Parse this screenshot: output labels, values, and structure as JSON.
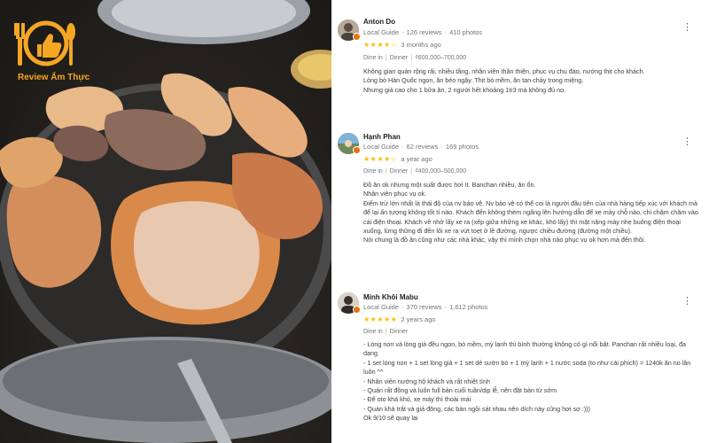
{
  "logo": {
    "text": "Review Ẩm Thực",
    "accent": "#f5a623"
  },
  "colors": {
    "star": "#fbbc04",
    "badge": "#e8710a",
    "meta": "#70757a"
  },
  "reviews": [
    {
      "name": "Anton Do",
      "guide": "Local Guide",
      "reviews_count": "126 reviews",
      "photos_count": "410 photos",
      "stars": "★★★★☆",
      "rating": 4,
      "time": "3 months ago",
      "meal": "Dine in",
      "meal_type": "Dinner",
      "price": "₫600,000–700,000",
      "text": "Không gian quán rộng rãi, nhiều tầng, nhân viên thân thiện, phục vụ chu đáo, nướng thịt cho khách.\nLòng bò Hàn Quốc ngon, ăn béo ngậy. Thịt bò mềm, ăn tan chảy trong miệng.\nNhưng giá cao cho 1 bữa ăn, 2 người hết khoảng 1tr3 mà không đủ no.",
      "more_icon": "more-vert-icon"
    },
    {
      "name": "Hạnh Phan",
      "guide": "Local Guide",
      "reviews_count": "62 reviews",
      "photos_count": "169 photos",
      "stars": "★★★★☆",
      "rating": 4,
      "time": "a year ago",
      "meal": "Dine in",
      "meal_type": "Dinner",
      "price": "₫400,000–500,000",
      "text": "Đồ ăn ok nhưng một suất được hơi ít. Banchan nhiều, ăn ổn.\nNhân viên phục vụ ok.\nĐiểm trừ lớn nhất là thái độ của nv bảo vệ. Nv bảo vệ có thể coi là người đầu tiên của nhà hàng tiếp xúc với khách mà để lại ấn tượng không tốt tí nào. Khách đến không thèm ngẩng lên hướng dẫn để xe máy chỗ nào, chỉ chăm chăm vào cái điện thoại. Khách về nhờ lấy xe ra (xếp giữa những xe khác, khó lấy) thì mặt nặng mày nhẹ buông điện thoại xuống, lừng thững đi đến lôi xe ra vứt toẹt ở lề đường, ngược chiều đường (đường một chiều).\nNói chung là đồ ăn cũng như các nhà khác, vậy thì mình chọn nhà nào phục vụ ok hơn mà đến thôi.",
      "more_icon": "more-vert-icon"
    },
    {
      "name": "Minh Khôi Mabu",
      "guide": "Local Guide",
      "reviews_count": "370 reviews",
      "photos_count": "1,612 photos",
      "stars": "★★★★★",
      "rating": 5,
      "time": "2 years ago",
      "meal": "Dine in",
      "meal_type": "Dinner",
      "price": "",
      "text": "- Lòng non và lòng già đều ngon, bò mềm, mỳ lạnh thì bình thường không có gì nổi bật. Panchan rất nhiều loại, đa dạng\n- 1 set lòng non + 1 set lòng già + 1 set dẻ sườn bò + 1 mỳ lạnh + 1 nước soda (to như cái phích) = 1240k ăn no lăn luôn ^^\n- Nhân viên nướng hộ khách và rất nhiệt tình\n- Quán rất đông và luôn full bàn cuối tuần/dịp lễ, nên đặt bàn từ sớm\n- Để oto khá khó, xe máy thì thoải mái\n- Quán khá trật và giá đông, các bàn ngồi sát nhau nên dích này cũng hơi sợ :)))\nOk 9/10 sẽ quay lại",
      "more_icon": "more-vert-icon"
    }
  ]
}
